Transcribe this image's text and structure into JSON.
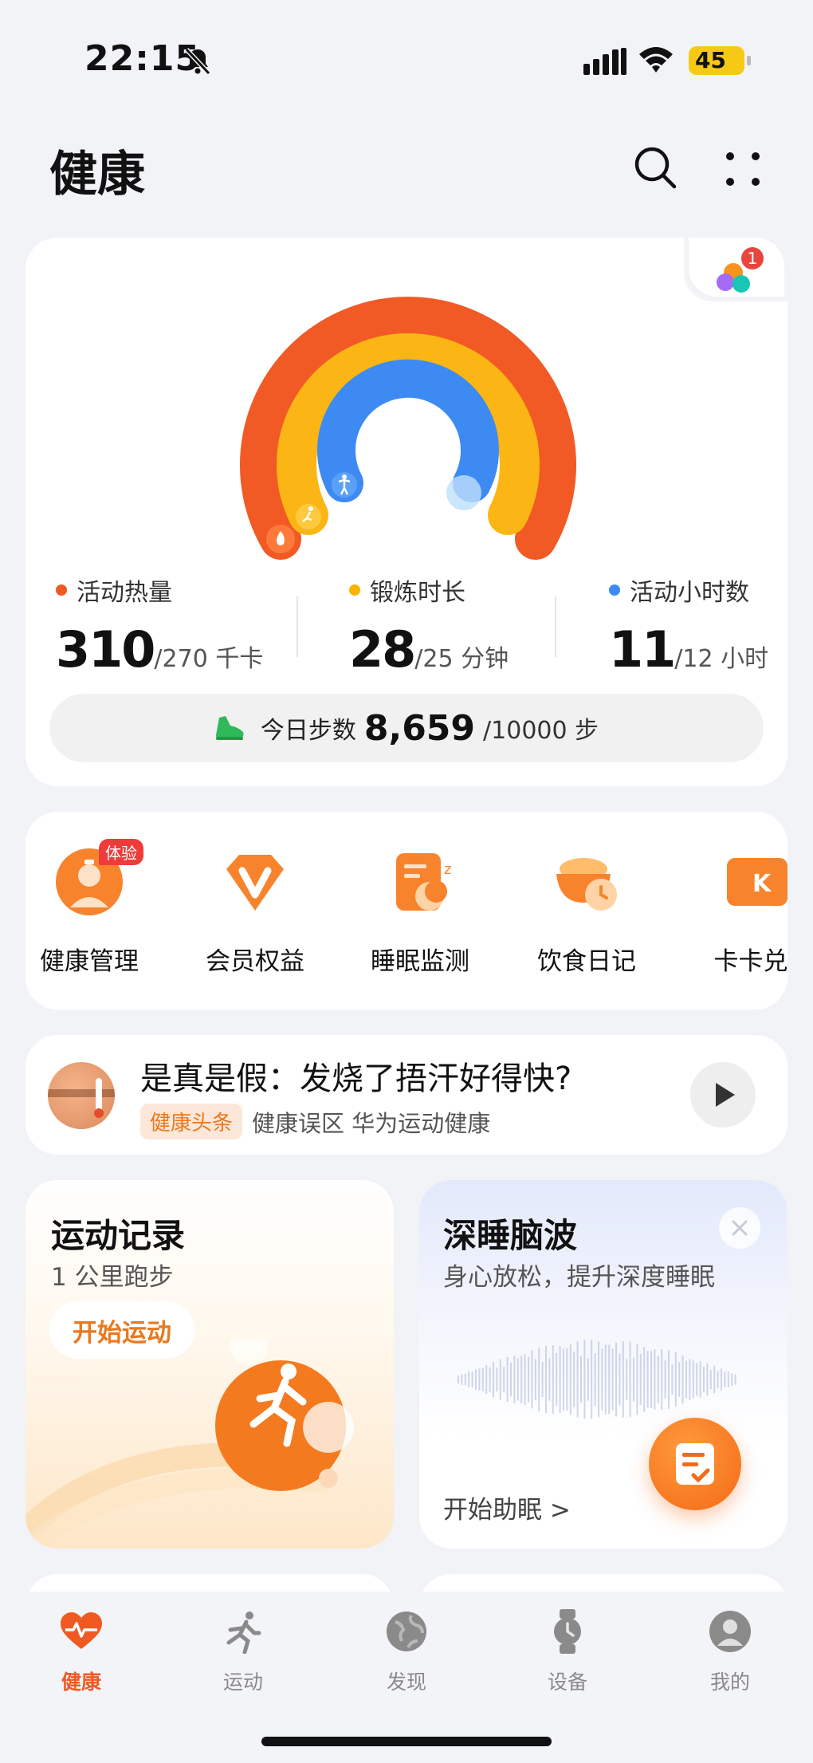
{
  "status_bar": {
    "time": "22:15",
    "battery": "45"
  },
  "header": {
    "title": "健康"
  },
  "activity": {
    "notification_count": "1",
    "stats": [
      {
        "label": "活动热量",
        "value": "310",
        "goal": "/270 千卡",
        "color": "#f05a22"
      },
      {
        "label": "锻炼时长",
        "value": "28",
        "goal": "/25 分钟",
        "color": "#f7b500"
      },
      {
        "label": "活动小时数",
        "value": "11",
        "goal": "/12 小时",
        "color": "#3d8bf2"
      }
    ],
    "steps": {
      "label": "今日步数",
      "value": "8,659",
      "goal": "/10000 步"
    }
  },
  "services": [
    {
      "name": "健康管理",
      "tag": "体验",
      "icon": "doctor-icon"
    },
    {
      "name": "会员权益",
      "icon": "vip-diamond-icon"
    },
    {
      "name": "睡眠监测",
      "icon": "sleep-icon"
    },
    {
      "name": "饮食日记",
      "icon": "food-bowl-icon"
    },
    {
      "name": "卡卡兑",
      "icon": "card-icon"
    }
  ],
  "news": {
    "title": "是真是假：发烧了捂汗好得快?",
    "tag": "健康头条",
    "source": "健康误区 华为运动健康"
  },
  "exercise": {
    "title": "运动记录",
    "subtitle": "1 公里跑步",
    "button": "开始运动"
  },
  "sleep": {
    "title": "深睡脑波",
    "subtitle": "身心放松，提升深度睡眠",
    "link": "开始助眠 >"
  },
  "nav": [
    {
      "label": "健康",
      "icon": "heart-pulse-icon",
      "active": true
    },
    {
      "label": "运动",
      "icon": "running-icon"
    },
    {
      "label": "发现",
      "icon": "globe-icon"
    },
    {
      "label": "设备",
      "icon": "watch-icon"
    },
    {
      "label": "我的",
      "icon": "profile-icon"
    }
  ]
}
